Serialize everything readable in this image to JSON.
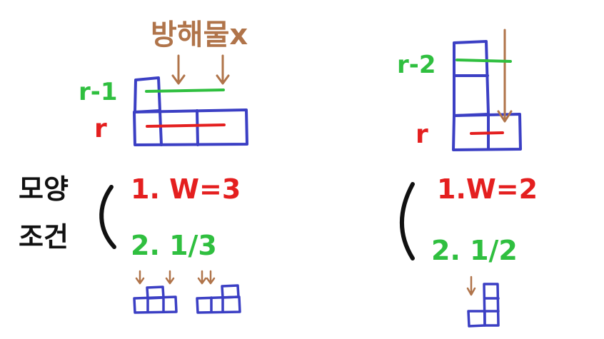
{
  "colors": {
    "blue": "#3b3fc4",
    "green": "#2fbf3f",
    "red": "#e41f1f",
    "brown": "#b0744a",
    "black": "#111111"
  },
  "left": {
    "obstacle_label": "방해물x",
    "row_upper_label": "r-1",
    "row_lower_label": "r",
    "condition_title_line1": "모양",
    "condition_title_line2": "조건",
    "condition_1": "1. W=3",
    "condition_2": "2.  1/3"
  },
  "right": {
    "row_upper_label": "r-2",
    "row_lower_label": "r",
    "condition_1": "1.W=2",
    "condition_2": "2.  1/2"
  },
  "icons": {
    "arrow": "down-arrow-icon",
    "brace": "left-paren-icon",
    "shape": "tetromino-icon"
  }
}
